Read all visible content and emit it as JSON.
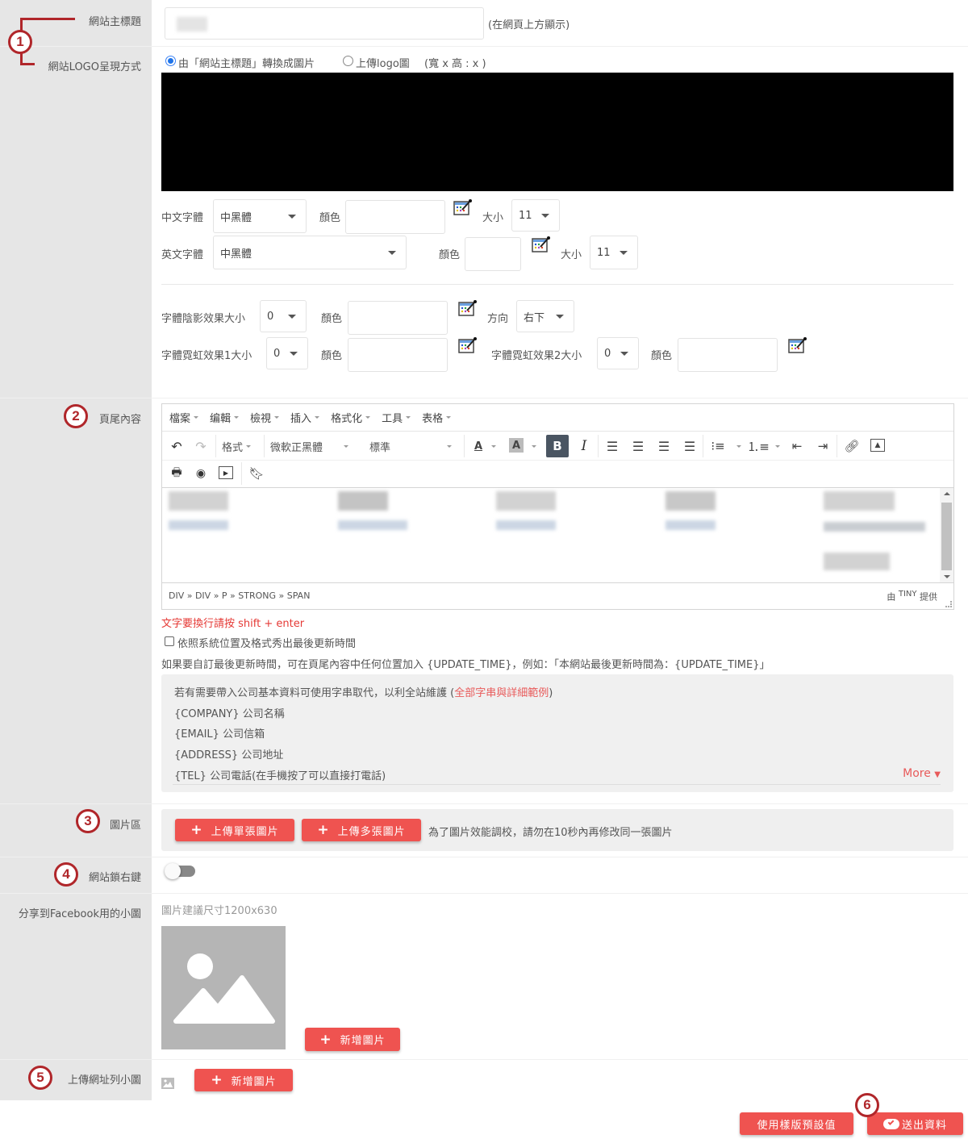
{
  "badges": [
    "1",
    "2",
    "3",
    "4",
    "5",
    "6"
  ],
  "labels": {
    "site_title": "網站主標題",
    "logo_mode": "網站LOGO呈現方式",
    "footer": "頁尾內容",
    "image_area": "圖片區",
    "lock_right_click": "網站鎖右鍵",
    "facebook_image": "分享到Facebook用的小圖",
    "url_list_image": "上傳網址列小圖"
  },
  "site_title": {
    "value": "",
    "hint": "(在網頁上方顯示)"
  },
  "logo_mode": {
    "option_text": "由「網站主標題」轉換成圖片",
    "option_upload": "上傳logo圖",
    "size_hint": "(寬 x 高 : x )",
    "selected": "text"
  },
  "font_settings": {
    "chinese_font_label": "中文字體",
    "chinese_font_value": "中黑體",
    "english_font_label": "英文字體",
    "english_font_value": "中黑體",
    "color_label": "顏色",
    "size_label": "大小",
    "chinese_size": "11",
    "english_size": "11",
    "shadow_size_label": "字體陰影效果大小",
    "shadow_size": "0",
    "direction_label": "方向",
    "direction": "右下",
    "neon1_label": "字體霓虹效果1大小",
    "neon1_size": "0",
    "neon2_label": "字體霓虹效果2大小",
    "neon2_size": "0"
  },
  "editor": {
    "menus": [
      "檔案",
      "编輯",
      "檢視",
      "插入",
      "格式化",
      "工具",
      "表格"
    ],
    "format_label": "格式",
    "font_family": "微軟正黑體",
    "font_size": "標準",
    "path": "DIV » DIV » P » STRONG » SPAN",
    "powered_prefix": "由",
    "powered_brand": "TINY",
    "powered_suffix": "提供"
  },
  "footer_notes": {
    "shift_enter_hint": "文字要換行請按 shift + enter",
    "show_update_time_label": "依照系統位置及格式秀出最後更新時間",
    "show_update_time_checked": false,
    "custom_update_hint": "如果要自訂最後更新時間，可在頁尾內容中任何位置加入 {UPDATE_TIME}，例如：「本網站最後更新時間為：{UPDATE_TIME}」"
  },
  "string_info": {
    "intro": "若有需要帶入公司基本資料可使用字串取代，以利全站維護 (",
    "link": "全部字串與詳細範例",
    "intro_end": ")",
    "items": [
      "{COMPANY} 公司名稱",
      "{EMAIL} 公司信箱",
      "{ADDRESS} 公司地址",
      "{TEL} 公司電話(在手機按了可以直接打電話)"
    ],
    "more": "More"
  },
  "image_area": {
    "upload_single": "上傳單張圖片",
    "upload_multi": "上傳多張圖片",
    "hint": "為了圖片效能調校，請勿在10秒內再修改同一張圖片"
  },
  "lock_right_click": {
    "enabled": false
  },
  "facebook_image": {
    "hint": "圖片建議尺寸1200x630",
    "add_button": "新增圖片"
  },
  "url_list_image": {
    "add_button": "新增圖片"
  },
  "actions": {
    "use_template_default": "使用樣版預設值",
    "submit": "送出資料"
  },
  "colors": {
    "accent": "#ef5350",
    "badge": "#b0262a",
    "label_bg": "#e6e6e6"
  }
}
